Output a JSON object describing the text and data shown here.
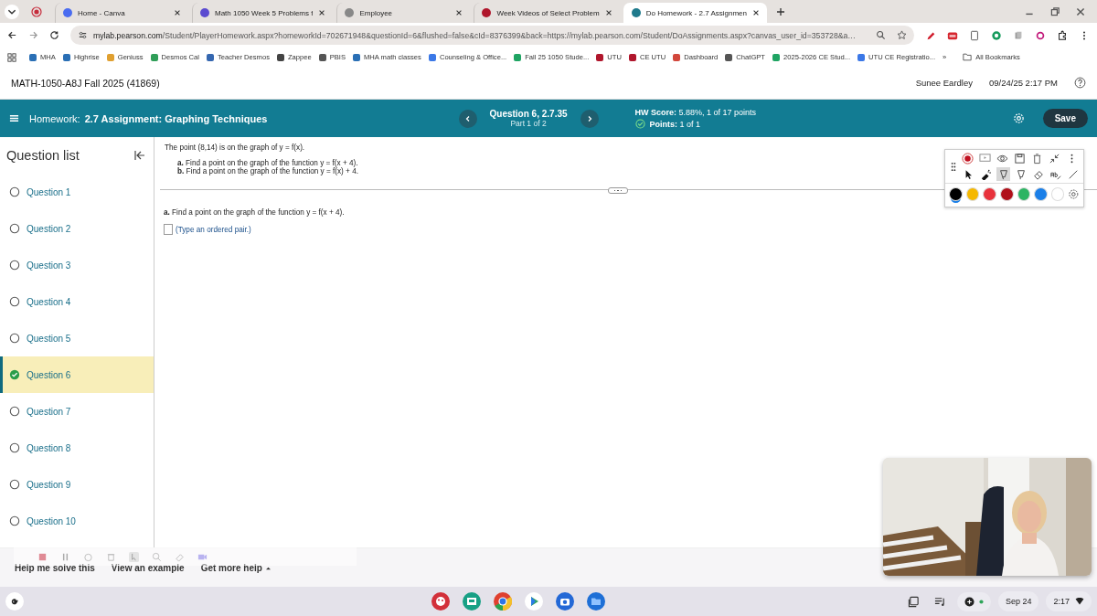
{
  "browser": {
    "tabs": [
      {
        "title": "Home - Canva",
        "selected": false,
        "kind": "canva"
      },
      {
        "title": "Math 1050 Week 5 Problems f",
        "selected": false,
        "kind": "badge"
      },
      {
        "title": "Employee",
        "selected": false,
        "kind": "dr"
      },
      {
        "title": "Week Videos of Select Problem",
        "selected": false,
        "kind": "ut"
      },
      {
        "title": "Do Homework - 2.7 Assignmen",
        "selected": true,
        "kind": "pearson"
      }
    ],
    "url_host": "mylab.pearson.com",
    "url_path": "/Student/PlayerHomework.aspx?homeworkId=702671948&questionId=6&flushed=false&cId=8376399&back=https://mylab.pearson.com/Student/DoAssignments.aspx?canvas_user_id=353728&a…",
    "bookmarks": [
      {
        "label": "MHA",
        "kind": "flame"
      },
      {
        "label": "Highrise",
        "kind": "flame"
      },
      {
        "label": "Geniuss",
        "kind": "bulb"
      },
      {
        "label": "Desmos Cal",
        "kind": "desmos"
      },
      {
        "label": "Teacher Desmos",
        "kind": "d"
      },
      {
        "label": "Zappee",
        "kind": "bolt"
      },
      {
        "label": "PBIS",
        "kind": "pbis"
      },
      {
        "label": "MHA math classes",
        "kind": "flame"
      },
      {
        "label": "Counseling & Office...",
        "kind": "doc"
      },
      {
        "label": "Fall 25 1050 Stude...",
        "kind": "sheet"
      },
      {
        "label": "UTU",
        "kind": "ut"
      },
      {
        "label": "CE UTU",
        "kind": "ut"
      },
      {
        "label": "Dashboard",
        "kind": "dashboard"
      },
      {
        "label": "ChatGPT",
        "kind": "chatgpt"
      },
      {
        "label": "2025-2026 CE Stud...",
        "kind": "sheet"
      },
      {
        "label": "UTU CE Registratio...",
        "kind": "doc"
      }
    ],
    "more_bookmarks": "»",
    "all_bookmarks": "All Bookmarks"
  },
  "header": {
    "course": "MATH-1050-A8J Fall 2025 (41869)",
    "user": "Sunee Eardley",
    "datetime": "09/24/25 2:17 PM"
  },
  "homework_bar": {
    "label": "Homework:",
    "title": "2.7 Assignment: Graphing Techniques",
    "question": "Question 6, 2.7.35",
    "part": "Part 1 of 2",
    "score_label": "HW Score:",
    "score": "5.88%, 1 of 17 points",
    "points_label": "Points:",
    "points": "1 of 1",
    "save": "Save"
  },
  "sidebar": {
    "title": "Question list",
    "questions": [
      {
        "label": "Question 1",
        "selected": false,
        "completed": false
      },
      {
        "label": "Question 2",
        "selected": false,
        "completed": false
      },
      {
        "label": "Question 3",
        "selected": false,
        "completed": false
      },
      {
        "label": "Question 4",
        "selected": false,
        "completed": false
      },
      {
        "label": "Question 5",
        "selected": false,
        "completed": false
      },
      {
        "label": "Question 6",
        "selected": true,
        "completed": true
      },
      {
        "label": "Question 7",
        "selected": false,
        "completed": false
      },
      {
        "label": "Question 8",
        "selected": false,
        "completed": false
      },
      {
        "label": "Question 9",
        "selected": false,
        "completed": false
      },
      {
        "label": "Question 10",
        "selected": false,
        "completed": false
      }
    ]
  },
  "question": {
    "intro": "The point (8,14) is on the graph of y = f(x).",
    "parts": [
      "**a.** Find a point on the graph of the function y = f(x + 4).",
      "**b.** Find a point on the graph of the function y = f(x) + 4."
    ],
    "answer_prompt": "**a.** Find a point on the graph of the function y = f(x + 4).",
    "answer_hint": "(Type an ordered pair.)"
  },
  "annotation": {
    "tools": [
      {
        "kind": "pointer",
        "selected": false
      },
      {
        "kind": "laser",
        "selected": false
      },
      {
        "kind": "highlighter",
        "selected": true
      },
      {
        "kind": "marker",
        "selected": false
      },
      {
        "kind": "eraser",
        "selected": false
      },
      {
        "kind": "text",
        "selected": false
      },
      {
        "kind": "line",
        "selected": false
      }
    ],
    "colors": [
      {
        "color": "#000000",
        "selected": true
      },
      {
        "color": "#f5b800",
        "selected": false
      },
      {
        "color": "#e8323c",
        "selected": false
      },
      {
        "color": "#b0101a",
        "selected": false
      },
      {
        "color": "#2db463",
        "selected": false
      },
      {
        "color": "#1a7fe8",
        "selected": false
      },
      {
        "color": "#ffffff",
        "selected": false
      }
    ]
  },
  "help": {
    "links": [
      "Help me solve this",
      "View an example"
    ],
    "more": "Get more help"
  },
  "taskbar": {
    "date": "Sep 24",
    "time": "2:17"
  }
}
